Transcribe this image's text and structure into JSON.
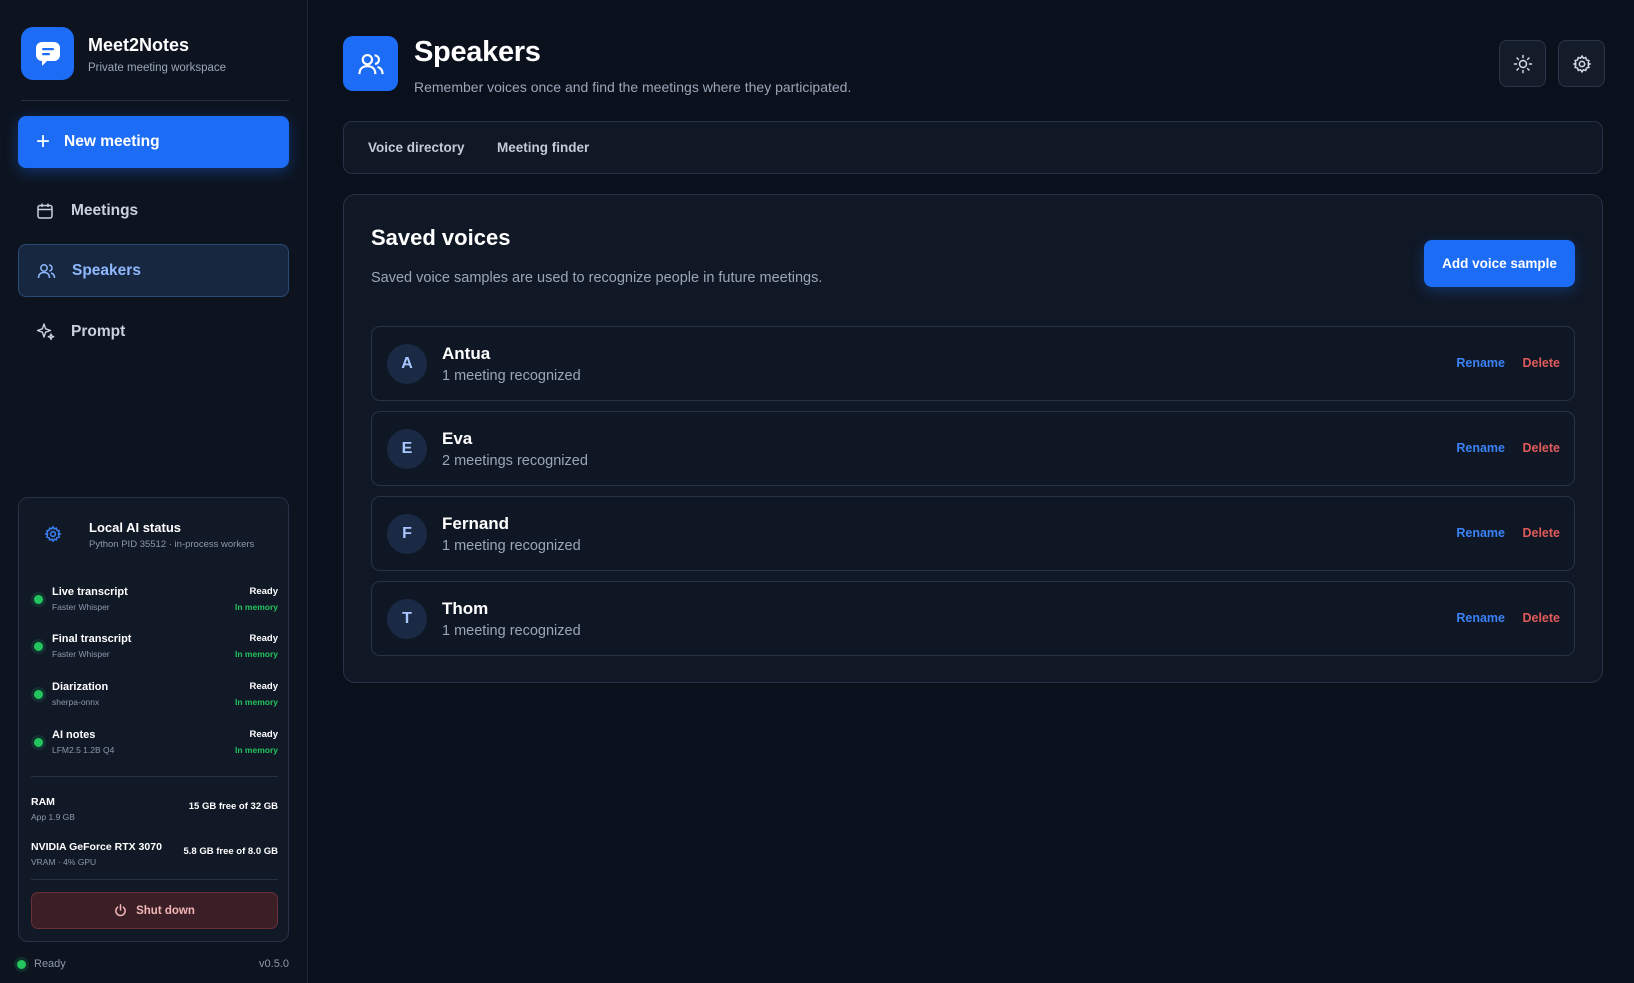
{
  "app": {
    "name": "Meet2Notes",
    "subtitle": "Private meeting workspace",
    "version": "v0.5.0",
    "footer_status": "Ready"
  },
  "sidebar": {
    "new_meeting_label": "New meeting",
    "items": [
      {
        "label": "Meetings",
        "icon": "calendar-icon",
        "active": false
      },
      {
        "label": "Speakers",
        "icon": "users-icon",
        "active": true
      },
      {
        "label": "Prompt",
        "icon": "sparkle-icon",
        "active": false
      }
    ]
  },
  "ai_status": {
    "title": "Local AI status",
    "pid_line": "Python PID 35512 · in-process workers",
    "services": [
      {
        "name": "Live transcript",
        "engine": "Faster Whisper",
        "state": "Ready",
        "memory": "In memory"
      },
      {
        "name": "Final transcript",
        "engine": "Faster Whisper",
        "state": "Ready",
        "memory": "In memory"
      },
      {
        "name": "Diarization",
        "engine": "sherpa-onnx",
        "state": "Ready",
        "memory": "In memory"
      },
      {
        "name": "AI notes",
        "engine": "LFM2.5 1.2B Q4",
        "state": "Ready",
        "memory": "In memory"
      }
    ],
    "resources": [
      {
        "name": "RAM",
        "sub": "App 1.9 GB",
        "value": "15 GB free of 32 GB"
      },
      {
        "name": "NVIDIA GeForce RTX 3070",
        "sub": "VRAM · 4% GPU",
        "value": "5.8 GB free of 8.0 GB"
      }
    ],
    "shutdown_label": "Shut down"
  },
  "page": {
    "title": "Speakers",
    "subtitle": "Remember voices once and find the meetings where they participated."
  },
  "tabs": [
    {
      "label": "Voice directory"
    },
    {
      "label": "Meeting finder"
    }
  ],
  "saved_voices": {
    "title": "Saved voices",
    "subtitle": "Saved voice samples are used to recognize people in future meetings.",
    "add_label": "Add voice sample",
    "rename_label": "Rename",
    "delete_label": "Delete",
    "voices": [
      {
        "initial": "A",
        "name": "Antua",
        "meta": "1 meeting recognized"
      },
      {
        "initial": "E",
        "name": "Eva",
        "meta": "2 meetings recognized"
      },
      {
        "initial": "F",
        "name": "Fernand",
        "meta": "1 meeting recognized"
      },
      {
        "initial": "T",
        "name": "Thom",
        "meta": "1 meeting recognized"
      }
    ]
  },
  "colors": {
    "accent": "#1d6cf5",
    "success": "#22c55e",
    "danger": "#e05b5b",
    "background": "#0b111c"
  }
}
